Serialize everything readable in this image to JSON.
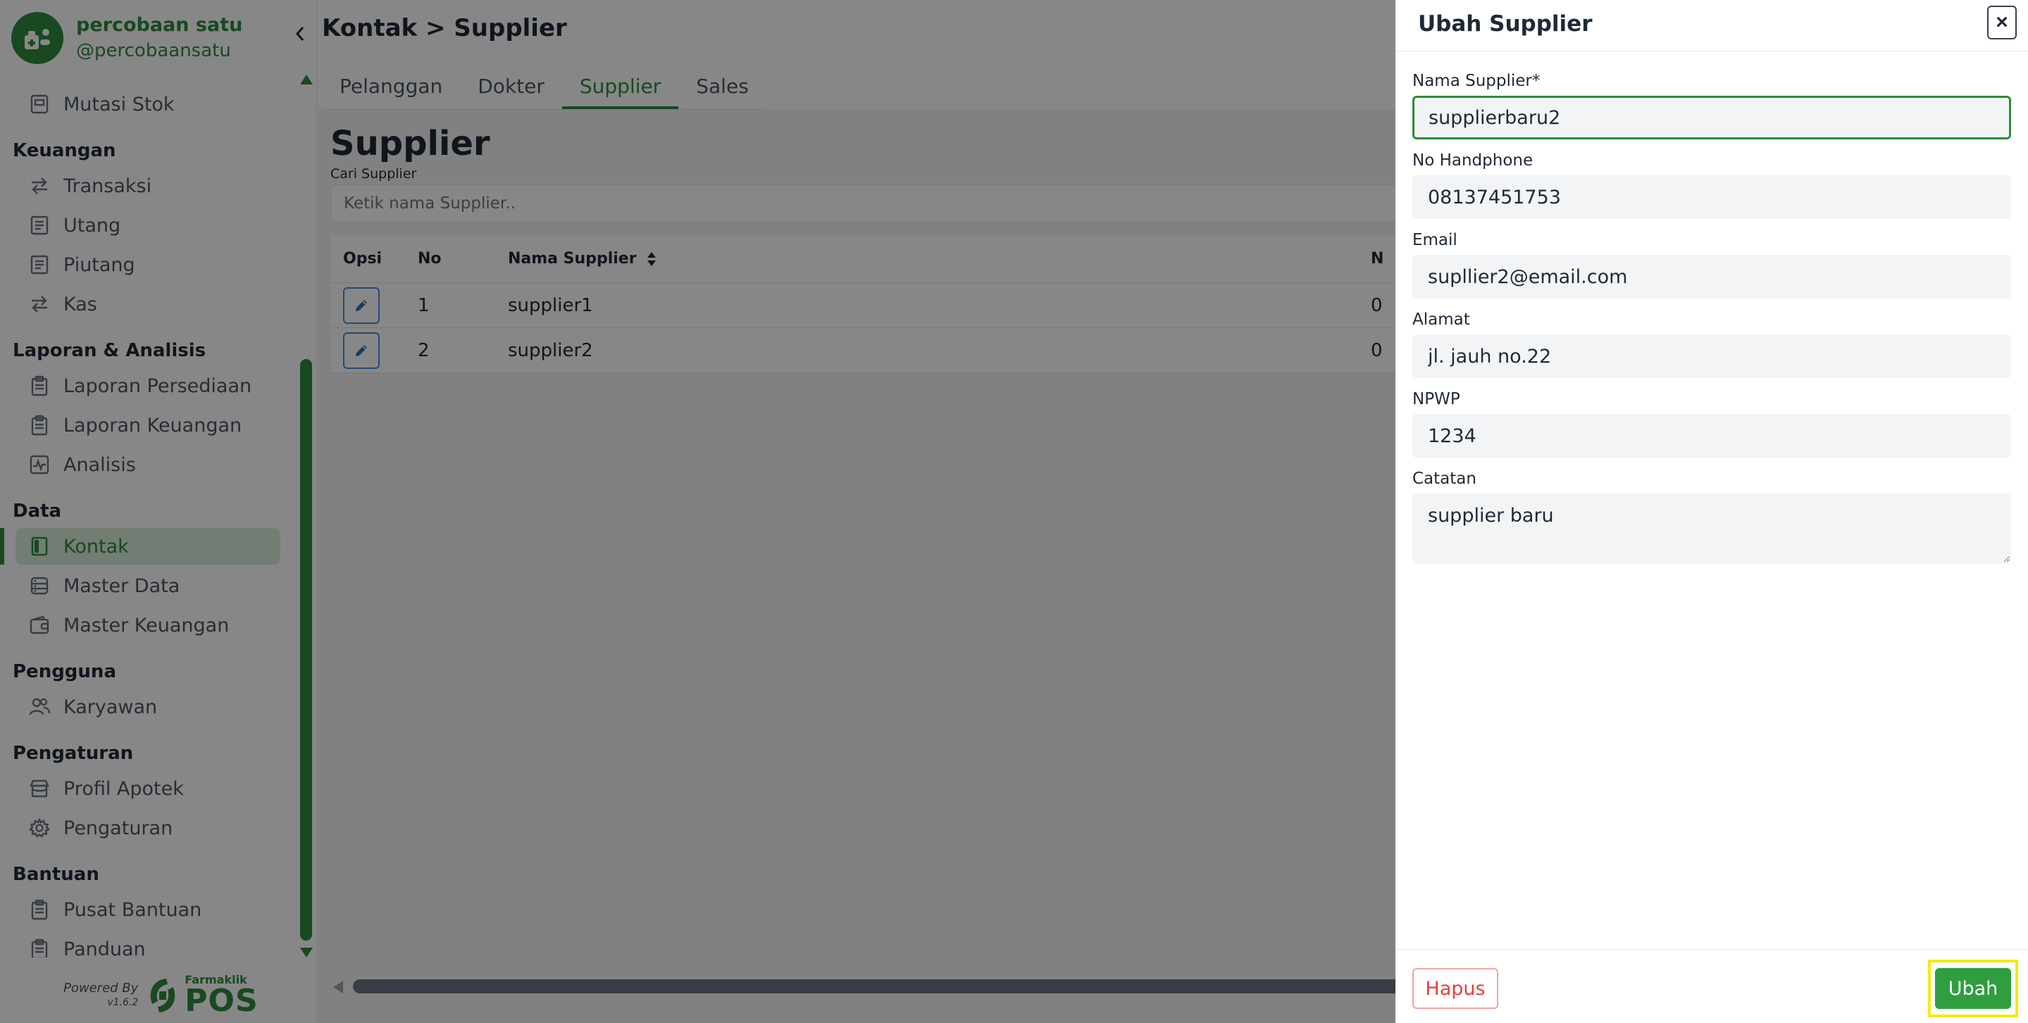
{
  "brand": {
    "name": "percobaan satu",
    "handle": "@percobaansatu"
  },
  "sidebar": {
    "top_item": {
      "label": "Mutasi Stok",
      "icon": "box-icon"
    },
    "sections": [
      {
        "title": "Keuangan",
        "items": [
          {
            "label": "Transaksi",
            "icon": "exchange-icon"
          },
          {
            "label": "Utang",
            "icon": "document-icon"
          },
          {
            "label": "Piutang",
            "icon": "document-icon"
          },
          {
            "label": "Kas",
            "icon": "exchange-icon"
          }
        ]
      },
      {
        "title": "Laporan & Analisis",
        "items": [
          {
            "label": "Laporan Persediaan",
            "icon": "clipboard-icon"
          },
          {
            "label": "Laporan Keuangan",
            "icon": "clipboard-icon"
          },
          {
            "label": "Analisis",
            "icon": "chart-icon"
          }
        ]
      },
      {
        "title": "Data",
        "items": [
          {
            "label": "Kontak",
            "icon": "contact-book-icon",
            "active": true
          },
          {
            "label": "Master Data",
            "icon": "database-icon"
          },
          {
            "label": "Master Keuangan",
            "icon": "wallet-icon"
          }
        ]
      },
      {
        "title": "Pengguna",
        "items": [
          {
            "label": "Karyawan",
            "icon": "users-icon"
          }
        ]
      },
      {
        "title": "Pengaturan",
        "items": [
          {
            "label": "Profil Apotek",
            "icon": "store-icon"
          },
          {
            "label": "Pengaturan",
            "icon": "gear-icon"
          }
        ]
      },
      {
        "title": "Bantuan",
        "items": [
          {
            "label": "Pusat Bantuan",
            "icon": "clipboard-icon"
          },
          {
            "label": "Panduan",
            "icon": "clipboard-icon"
          }
        ]
      }
    ],
    "powered_by": "Powered By",
    "version": "v1.6.2",
    "logo_small": "Farmaklik",
    "logo_big": "POS"
  },
  "header": {
    "breadcrumb": "Kontak > Supplier"
  },
  "tabs": [
    "Pelanggan",
    "Dokter",
    "Supplier",
    "Sales"
  ],
  "active_tab": "Supplier",
  "page": {
    "title": "Supplier",
    "search_label": "Cari Supplier",
    "search_placeholder": "Ketik nama Supplier.."
  },
  "table": {
    "columns": [
      "Opsi",
      "No",
      "Nama Supplier",
      "N"
    ],
    "rows": [
      {
        "no": "1",
        "name": "supplier1",
        "n": "0"
      },
      {
        "no": "2",
        "name": "supplier2",
        "n": "0"
      }
    ]
  },
  "drawer": {
    "title": "Ubah Supplier",
    "fields": {
      "nama": {
        "label": "Nama Supplier*",
        "value": "supplierbaru2"
      },
      "phone": {
        "label": "No Handphone",
        "value": "08137451753"
      },
      "email": {
        "label": "Email",
        "value": "supllier2@email.com"
      },
      "alamat": {
        "label": "Alamat",
        "value": "jl. jauh no.22"
      },
      "npwp": {
        "label": "NPWP",
        "value": "1234"
      },
      "catatan": {
        "label": "Catatan",
        "value": "supplier baru"
      }
    },
    "delete_label": "Hapus",
    "submit_label": "Ubah"
  },
  "colors": {
    "brand": "#2e8b3d",
    "danger": "#e53e3e",
    "highlight": "#f5ea14"
  }
}
